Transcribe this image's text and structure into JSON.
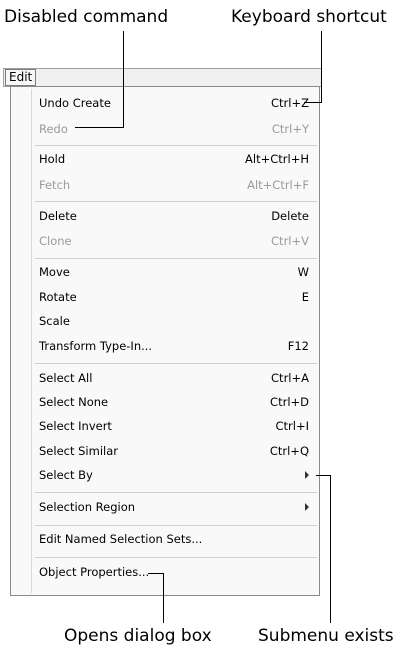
{
  "callouts": {
    "disabled_command": "Disabled command",
    "keyboard_shortcut": "Keyboard shortcut",
    "opens_dialog_box": "Opens dialog box",
    "submenu_exists": "Submenu exists"
  },
  "menubar": {
    "edit_label": "Edit"
  },
  "menu": {
    "items": [
      {
        "label": "Undo Create",
        "shortcut": "Ctrl+Z"
      },
      {
        "label": "Redo",
        "shortcut": "Ctrl+Y",
        "disabled": true
      },
      {
        "label": "Hold",
        "shortcut": "Alt+Ctrl+H"
      },
      {
        "label": "Fetch",
        "shortcut": "Alt+Ctrl+F",
        "disabled": true
      },
      {
        "label": "Delete",
        "shortcut": "Delete"
      },
      {
        "label": "Clone",
        "shortcut": "Ctrl+V",
        "disabled": true
      },
      {
        "label": "Move",
        "shortcut": "W"
      },
      {
        "label": "Rotate",
        "shortcut": "E"
      },
      {
        "label": "Scale",
        "shortcut": ""
      },
      {
        "label": "Transform Type-In...",
        "shortcut": "F12"
      },
      {
        "label": "Select All",
        "shortcut": "Ctrl+A"
      },
      {
        "label": "Select None",
        "shortcut": "Ctrl+D"
      },
      {
        "label": "Select Invert",
        "shortcut": "Ctrl+I"
      },
      {
        "label": "Select Similar",
        "shortcut": "Ctrl+Q"
      },
      {
        "label": "Select By",
        "shortcut": "",
        "submenu": true
      },
      {
        "label": "Selection Region",
        "shortcut": "",
        "submenu": true
      },
      {
        "label": "Edit Named Selection Sets...",
        "shortcut": ""
      },
      {
        "label": "Object Properties...",
        "shortcut": ""
      }
    ]
  }
}
